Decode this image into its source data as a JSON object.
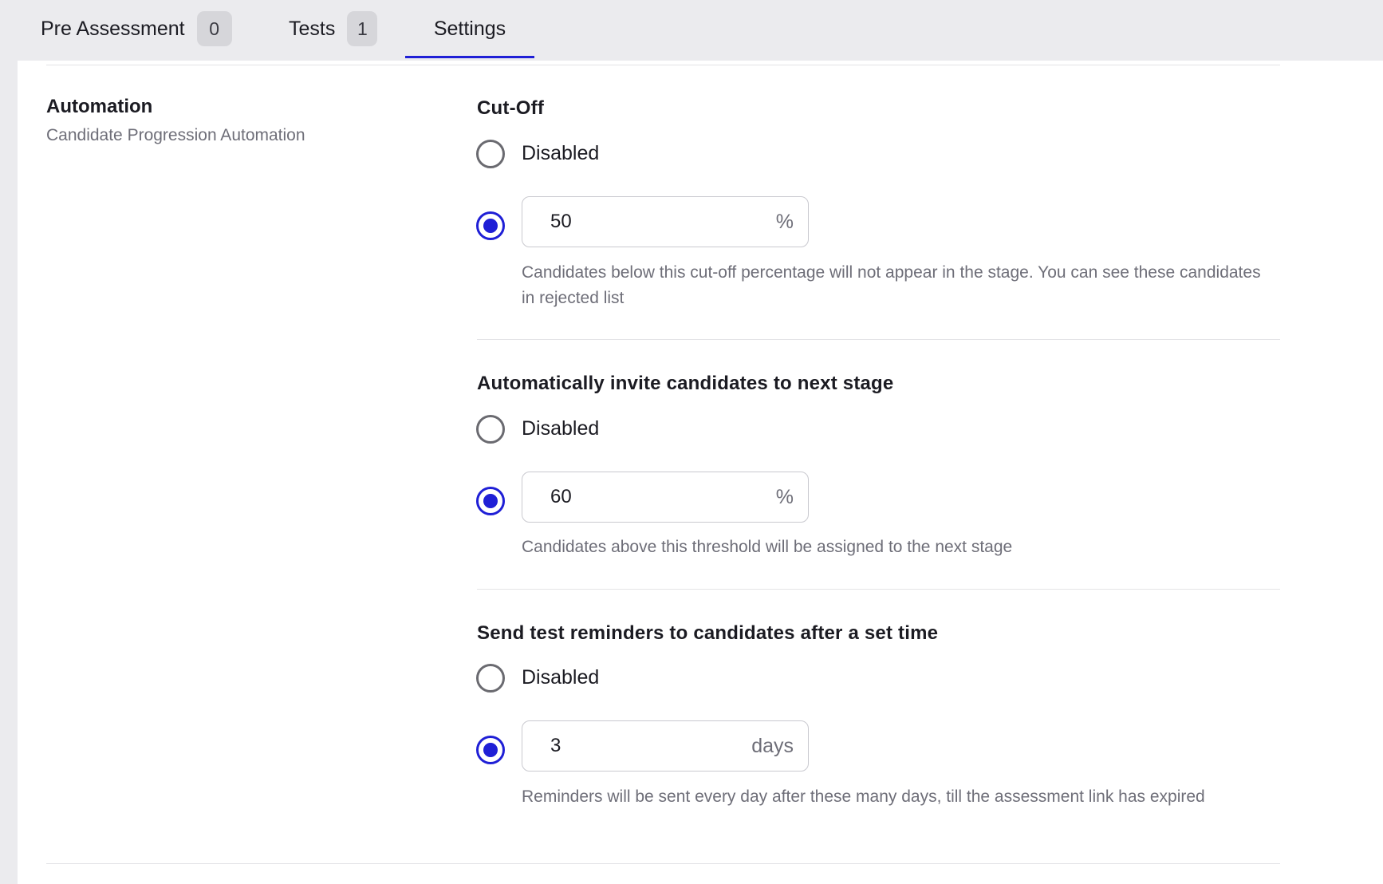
{
  "tabs": [
    {
      "label": "Pre Assessment",
      "count": "0"
    },
    {
      "label": "Tests",
      "count": "1"
    },
    {
      "label": "Settings"
    }
  ],
  "automation": {
    "title": "Automation",
    "subtitle": "Candidate Progression Automation"
  },
  "cutoff": {
    "title": "Cut-Off",
    "disabled_label": "Disabled",
    "value": "50",
    "unit": "%",
    "help": "Candidates below this cut-off percentage will not appear in the stage. You can see these candidates in rejected list",
    "selected": "value"
  },
  "auto_invite": {
    "title": "Automatically invite candidates to next stage",
    "disabled_label": "Disabled",
    "value": "60",
    "unit": "%",
    "help": "Candidates above this threshold will be assigned to the next stage",
    "selected": "value"
  },
  "reminders": {
    "title": "Send test reminders to candidates after a set time",
    "disabled_label": "Disabled",
    "value": "3",
    "unit": "days",
    "help": "Reminders will be sent every day after these many days, till the assessment link has expired",
    "selected": "value"
  },
  "colors": {
    "accent": "#1f1fd6",
    "background": "#ebebee",
    "muted_text": "#6e6e78"
  }
}
